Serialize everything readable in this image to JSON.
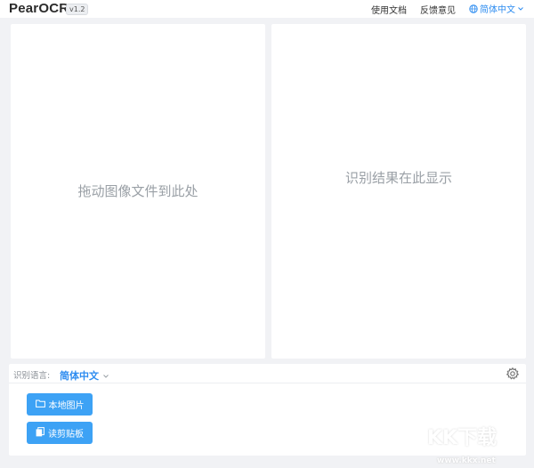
{
  "app": {
    "name": "PearOCR",
    "version": "v1.2"
  },
  "topnav": {
    "docs": "使用文档",
    "feedback": "反馈意见",
    "language": "简体中文"
  },
  "panels": {
    "drop_hint": "拖动图像文件到此处",
    "result_hint": "识别结果在此显示"
  },
  "bottom": {
    "lang_label": "识别语言:",
    "lang_value": "简体中文",
    "local_image_button": "本地图片",
    "clipboard_button": "读剪贴板"
  },
  "watermark": {
    "text": "KK下载",
    "url": "www.kkx.net"
  },
  "colors": {
    "accent": "#2d8cf0",
    "button": "#3da2f5",
    "background": "#f1f2f5"
  }
}
